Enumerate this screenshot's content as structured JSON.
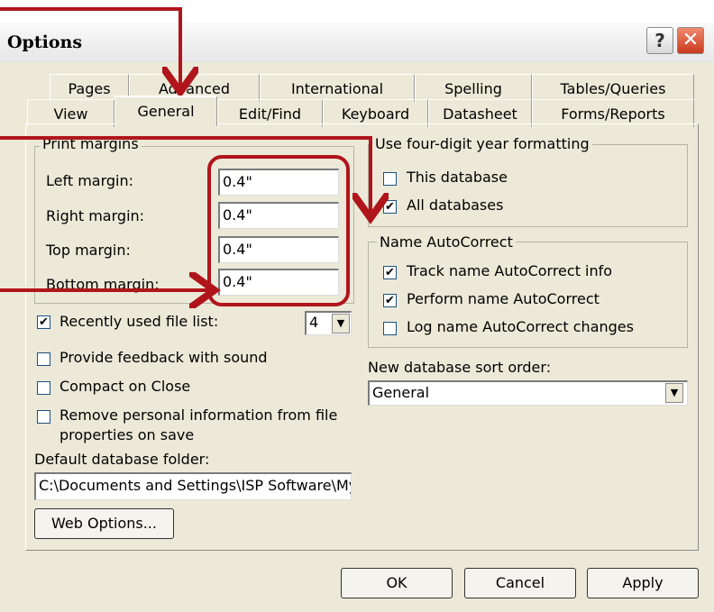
{
  "window": {
    "title": "Options",
    "help_label": "?",
    "close_label": "✕"
  },
  "tabs_row1": [
    "Pages",
    "Advanced",
    "International",
    "Spelling",
    "Tables/Queries"
  ],
  "tabs_row2": [
    "View",
    "General",
    "Edit/Find",
    "Keyboard",
    "Datasheet",
    "Forms/Reports"
  ],
  "active_tab": "General",
  "print_margins": {
    "legend": "Print margins",
    "left_label": "Left margin:",
    "left_value": "0.4\"",
    "right_label": "Right margin:",
    "right_value": "0.4\"",
    "top_label": "Top margin:",
    "top_value": "0.4\"",
    "bottom_label": "Bottom margin:",
    "bottom_value": "0.4\""
  },
  "recent_files": {
    "label": "Recently used file list:",
    "checked": true,
    "value": "4"
  },
  "feedback_sound": {
    "label": "Provide feedback with sound",
    "checked": false
  },
  "compact_close": {
    "label": "Compact on Close",
    "checked": false
  },
  "remove_personal": {
    "label_line1": "Remove personal information from file",
    "label_line2": "properties on save",
    "checked": false
  },
  "default_folder": {
    "label": "Default database folder:",
    "value": "C:\\Documents and Settings\\ISP Software\\My"
  },
  "web_options_label": "Web Options...",
  "year_format": {
    "legend": "Use four-digit year formatting",
    "this_db": {
      "label": "This database",
      "checked": false
    },
    "all_db": {
      "label": "All databases",
      "checked": true
    }
  },
  "name_autocorrect": {
    "legend": "Name AutoCorrect",
    "track": {
      "label": "Track name AutoCorrect info",
      "checked": true
    },
    "perform": {
      "label": "Perform name AutoCorrect",
      "checked": true
    },
    "log": {
      "label": "Log name AutoCorrect changes",
      "checked": false
    }
  },
  "sort_order": {
    "label": "New database sort order:",
    "value": "General"
  },
  "buttons": {
    "ok": "OK",
    "cancel": "Cancel",
    "apply": "Apply"
  },
  "check_glyph": "✔",
  "annotation_color": "#b0151c"
}
